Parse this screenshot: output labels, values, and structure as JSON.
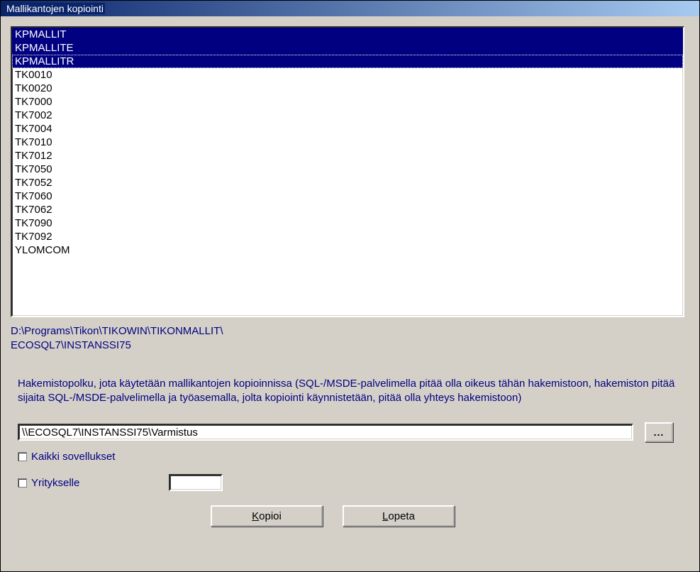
{
  "window": {
    "title": "Mallikantojen kopiointi"
  },
  "listbox": {
    "items": [
      {
        "label": "KPMALLIT",
        "selected": true,
        "focus": false
      },
      {
        "label": "KPMALLITE",
        "selected": true,
        "focus": false
      },
      {
        "label": "KPMALLITR",
        "selected": true,
        "focus": true
      },
      {
        "label": "TK0010",
        "selected": false,
        "focus": false
      },
      {
        "label": "TK0020",
        "selected": false,
        "focus": false
      },
      {
        "label": "TK7000",
        "selected": false,
        "focus": false
      },
      {
        "label": "TK7002",
        "selected": false,
        "focus": false
      },
      {
        "label": "TK7004",
        "selected": false,
        "focus": false
      },
      {
        "label": "TK7010",
        "selected": false,
        "focus": false
      },
      {
        "label": "TK7012",
        "selected": false,
        "focus": false
      },
      {
        "label": "TK7050",
        "selected": false,
        "focus": false
      },
      {
        "label": "TK7052",
        "selected": false,
        "focus": false
      },
      {
        "label": "TK7060",
        "selected": false,
        "focus": false
      },
      {
        "label": "TK7062",
        "selected": false,
        "focus": false
      },
      {
        "label": "TK7090",
        "selected": false,
        "focus": false
      },
      {
        "label": "TK7092",
        "selected": false,
        "focus": false
      },
      {
        "label": "YLOMCOM",
        "selected": false,
        "focus": false
      }
    ]
  },
  "info": {
    "line1": "D:\\Programs\\Tikon\\TIKOWIN\\TIKONMALLIT\\",
    "line2": "ECOSQL7\\INSTANSSI75"
  },
  "help": {
    "text": "Hakemistopolku, jota käytetään mallikantojen kopioinnissa (SQL-/MSDE-palvelimella pitää olla oikeus tähän hakemistoon, hakemiston pitää sijaita SQL-/MSDE-palvelimella ja työasemalla, jolta kopiointi käynnistetään, pitää olla yhteys hakemistoon)"
  },
  "path": {
    "value": "\\\\ECOSQL7\\INSTANSSI75\\Varmistus",
    "browse_label": "..."
  },
  "checks": {
    "all_apps_label": "Kaikki sovellukset",
    "company_label": "Yritykselle",
    "company_value": ""
  },
  "buttons": {
    "copy_label": "Kopioi",
    "copy_hotkey": "K",
    "quit_label": "Lopeta",
    "quit_hotkey": "L"
  }
}
